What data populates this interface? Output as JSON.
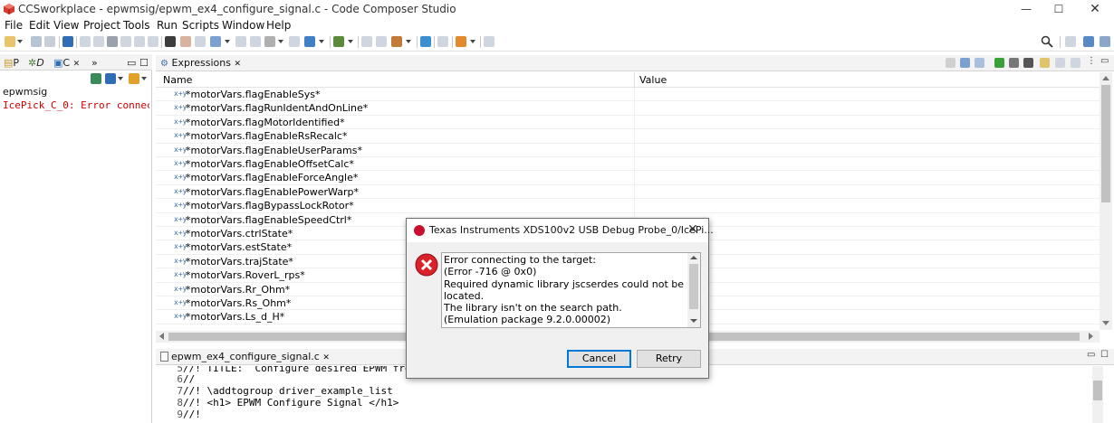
{
  "window": {
    "title": "CCSworkplace - epwmsig/epwm_ex4_configure_signal.c - Code Composer Studio",
    "controls": {
      "minimize": "—",
      "maximize": "☐",
      "close": "✕"
    }
  },
  "menu": [
    "File",
    "Edit",
    "View",
    "Project",
    "Tools",
    "Run",
    "Scripts",
    "Window",
    "Help"
  ],
  "left_panel": {
    "tabs": [
      "P",
      "D",
      "C",
      "»"
    ],
    "project_name": "epwmsig",
    "error_entry": "IcePick_C_0: Error connec"
  },
  "expressions": {
    "tab_label": "Expressions",
    "columns": {
      "name": "Name",
      "value": "Value"
    },
    "rows": [
      "*motorVars.flagEnableSys*",
      "*motorVars.flagRunIdentAndOnLine*",
      "*motorVars.flagMotorIdentified*",
      "*motorVars.flagEnableRsRecalc*",
      "*motorVars.flagEnableUserParams*",
      "*motorVars.flagEnableOffsetCalc*",
      "*motorVars.flagEnableForceAngle*",
      "*motorVars.flagEnablePowerWarp*",
      "*motorVars.flagBypassLockRotor*",
      "*motorVars.flagEnableSpeedCtrl*",
      "*motorVars.ctrlState*",
      "*motorVars.estState*",
      "*motorVars.trajState*",
      "*motorVars.RoverL_rps*",
      "*motorVars.Rr_Ohm*",
      "*motorVars.Rs_Ohm*",
      "*motorVars.Ls_d_H*"
    ],
    "row_icon": "x+y"
  },
  "editor": {
    "tab_label": "epwm_ex4_configure_signal.c",
    "lines": [
      {
        "num": "5",
        "text": "//! TITLE:  Configure desired EPWM frequency"
      },
      {
        "num": "6",
        "text": "//"
      },
      {
        "num": "7",
        "text": "//! \\addtogroup driver_example_list"
      },
      {
        "num": "8",
        "text": "//! <h1> EPWM Configure Signal </h1>"
      },
      {
        "num": "9",
        "text": "//!"
      }
    ]
  },
  "dialog": {
    "title": "Texas Instruments XDS100v2 USB Debug Probe_0/IcePi...",
    "close": "✕",
    "message": [
      "Error connecting to the target:",
      "(Error -716 @ 0x0)",
      "Required dynamic library jscserdes could not be",
      "located.",
      "The library isn't on the search path.",
      "(Emulation package 9.2.0.00002)"
    ],
    "buttons": {
      "cancel": "Cancel",
      "retry": "Retry"
    }
  },
  "colors": {
    "error_text": "#d10000",
    "dialog_error_icon": "#c8102e",
    "default_button_border": "#0078d7"
  }
}
